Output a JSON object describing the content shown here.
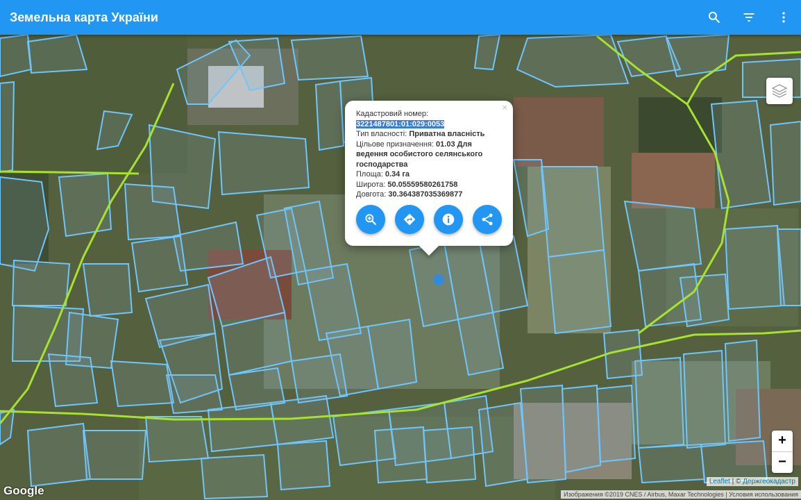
{
  "app": {
    "title": "Земельна карта України"
  },
  "toolbar": {
    "search_icon": "search-icon",
    "filter_icon": "filter-icon",
    "menu_icon": "more-vert-icon"
  },
  "map": {
    "layers_icon": "layers-icon",
    "zoom_in": "+",
    "zoom_out": "−",
    "attribution_leaflet": "Leaflet",
    "attribution_sep": " | © ",
    "attribution_owner": "Держгеокадастр",
    "imagery_credit": "Изображения ©2019 CNES / Airbus, Maxar Technologies",
    "terms": "Условия использования",
    "google_logo": "Google",
    "colors": {
      "parcel": "#6ec6ff",
      "road": "#a6e22e",
      "appbar": "#2196f3"
    }
  },
  "popup": {
    "close": "×",
    "cadastral_label": "Кадастровий номер:",
    "cadastral_number": "3221487801:01:029:0053",
    "ownership_label": "Тип власності: ",
    "ownership_value": "Приватна власність",
    "purpose_label": "Цільове призначення: ",
    "purpose_value": "01.03 Для ведення особистого селянського господарства",
    "area_label": "Площа: ",
    "area_value": "0.34 га",
    "lat_label": "Широта: ",
    "lat_value": "50.05559580261758",
    "lon_label": "Довгота: ",
    "lon_value": "30.364387035369877",
    "buttons": [
      "zoom-icon",
      "directions-icon",
      "info-icon",
      "share-icon"
    ]
  }
}
